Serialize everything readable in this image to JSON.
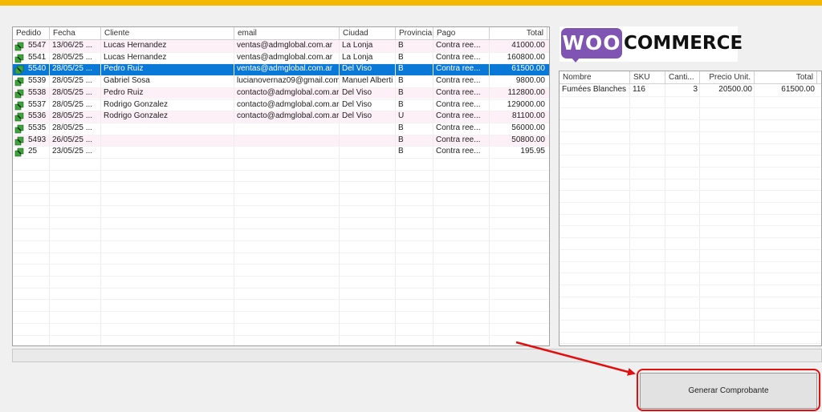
{
  "orders_grid": {
    "columns": [
      "Pedido",
      "Fecha",
      "Cliente",
      "email",
      "Ciudad",
      "Provincia",
      "Pago",
      "Total"
    ],
    "rows": [
      {
        "pedido": "5547",
        "fecha": "13/06/25 ...",
        "cliente": "Lucas Hernandez",
        "email": "ventas@admglobal.com.ar",
        "ciudad": "La Lonja",
        "provincia": "B",
        "pago": "Contra ree...",
        "total": "41000.00"
      },
      {
        "pedido": "5541",
        "fecha": "28/05/25 ...",
        "cliente": "Lucas Hernandez",
        "email": "ventas@admglobal.com.ar",
        "ciudad": "La Lonja",
        "provincia": "B",
        "pago": "Contra ree...",
        "total": "160800.00"
      },
      {
        "pedido": "5540",
        "fecha": "28/05/25 ...",
        "cliente": "Pedro Ruiz",
        "email": "ventas@admglobal.com.ar",
        "ciudad": "Del Viso",
        "provincia": "B",
        "pago": "Contra ree...",
        "total": "61500.00"
      },
      {
        "pedido": "5539",
        "fecha": "28/05/25 ...",
        "cliente": "Gabriel Sosa",
        "email": "lucianovernaz09@gmail.com",
        "ciudad": "Manuel Alberti",
        "provincia": "B",
        "pago": "Contra ree...",
        "total": "9800.00"
      },
      {
        "pedido": "5538",
        "fecha": "28/05/25 ...",
        "cliente": "Pedro Ruiz",
        "email": "contacto@admglobal.com.ar",
        "ciudad": "Del Viso",
        "provincia": "B",
        "pago": "Contra ree...",
        "total": "112800.00"
      },
      {
        "pedido": "5537",
        "fecha": "28/05/25 ...",
        "cliente": "Rodrigo Gonzalez",
        "email": "contacto@admglobal.com.ar",
        "ciudad": "Del Viso",
        "provincia": "B",
        "pago": "Contra ree...",
        "total": "129000.00"
      },
      {
        "pedido": "5536",
        "fecha": "28/05/25 ...",
        "cliente": "Rodrigo Gonzalez",
        "email": "contacto@admglobal.com.ar",
        "ciudad": "Del Viso",
        "provincia": "U",
        "pago": "Contra ree...",
        "total": "81100.00"
      },
      {
        "pedido": "5535",
        "fecha": "28/05/25 ...",
        "cliente": "",
        "email": "",
        "ciudad": "",
        "provincia": "B",
        "pago": "Contra ree...",
        "total": "56000.00"
      },
      {
        "pedido": "5493",
        "fecha": "26/05/25 ...",
        "cliente": "",
        "email": "",
        "ciudad": "",
        "provincia": "B",
        "pago": "Contra ree...",
        "total": "50800.00"
      },
      {
        "pedido": "25",
        "fecha": "23/05/25 ...",
        "cliente": "",
        "email": "",
        "ciudad": "",
        "provincia": "B",
        "pago": "Contra ree...",
        "total": "195.95"
      }
    ],
    "selected_index": 2
  },
  "logo": {
    "woo": "WOO",
    "commerce": "COMMERCE",
    "woo_color": "#7f54b3"
  },
  "items_grid": {
    "columns": [
      "Nombre",
      "SKU",
      "Canti...",
      "Precio Unit.",
      "Total"
    ],
    "rows": [
      {
        "nombre": "Fumées Blanches",
        "sku": "116",
        "cantidad": "3",
        "precio": "20500.00",
        "total": "61500.00"
      }
    ]
  },
  "generate_button": {
    "label": "Generar Comprobante"
  },
  "colors": {
    "selection": "#0a78d7",
    "alt_row": "#fdf0f6",
    "accent_bar": "#f5b800",
    "highlight": "#e01010"
  }
}
